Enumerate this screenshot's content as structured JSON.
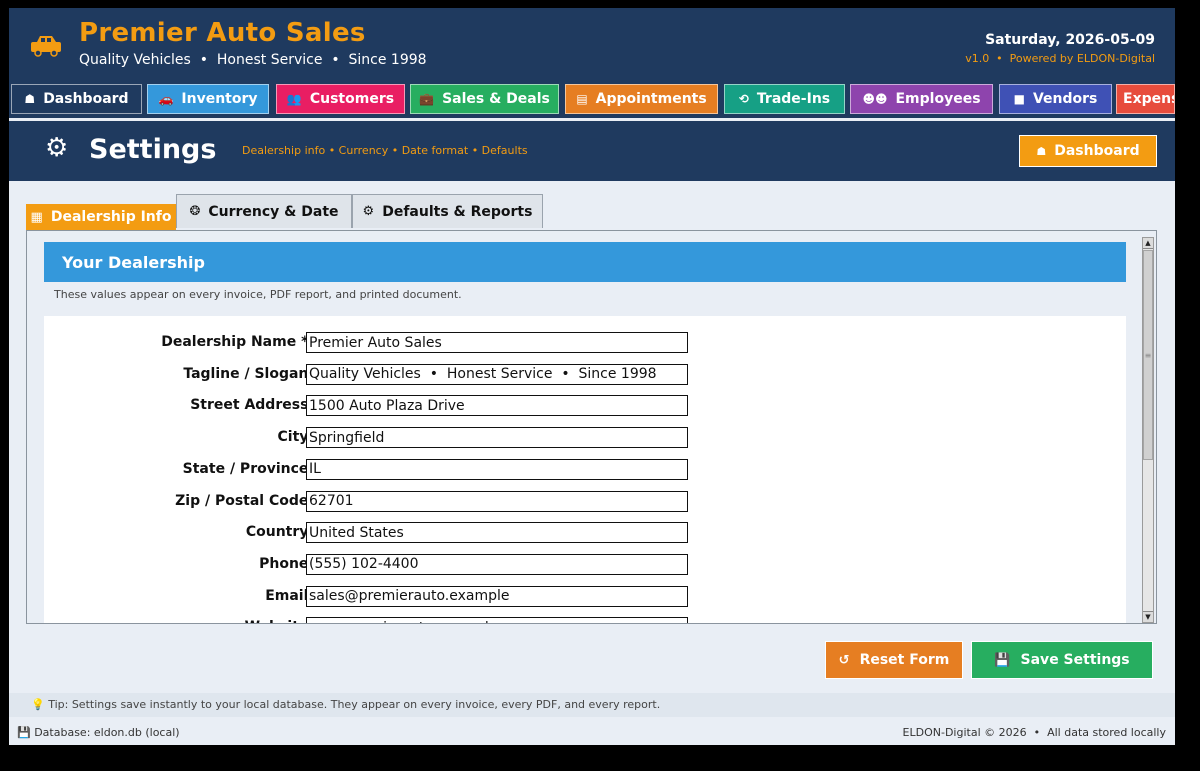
{
  "app": {
    "title": "Premier Auto Sales",
    "tagline": "Quality Vehicles  •  Honest Service  •  Since 1998",
    "date": "Saturday, 2026-05-09",
    "version": "v1.0  •  Powered by ELDON-Digital",
    "logo_icon": "car-icon"
  },
  "nav": [
    {
      "label": "Dashboard",
      "icon": "home-icon",
      "glyph": "☗",
      "color": "#1f3a5f"
    },
    {
      "label": "Inventory",
      "icon": "car-icon",
      "glyph": "🚗",
      "color": "#3498db"
    },
    {
      "label": "Customers",
      "icon": "people-icon",
      "glyph": "👥",
      "color": "#e91e63"
    },
    {
      "label": "Sales & Deals",
      "icon": "briefcase-icon",
      "glyph": "💼",
      "color": "#27ae60"
    },
    {
      "label": "Appointments",
      "icon": "calendar-icon",
      "glyph": "▤",
      "color": "#e67e22"
    },
    {
      "label": "Trade-Ins",
      "icon": "cycle-icon",
      "glyph": "⟲",
      "color": "#16a085"
    },
    {
      "label": "Employees",
      "icon": "staff-icon",
      "glyph": "☻☻",
      "color": "#8e44ad"
    },
    {
      "label": "Vendors",
      "icon": "box-icon",
      "glyph": "■",
      "color": "#3f51b5"
    },
    {
      "label": "Expens",
      "icon": "money-icon",
      "glyph": "",
      "color": "#e74c3c"
    }
  ],
  "page": {
    "title": "Settings",
    "subtitle": "Dealership info • Currency • Date format • Defaults",
    "dashboard_button": "Dashboard"
  },
  "tabs": [
    {
      "label": "Dealership Info",
      "icon": "building-icon",
      "glyph": "▦",
      "active": true
    },
    {
      "label": "Currency & Date",
      "icon": "globe-icon",
      "glyph": "❂",
      "active": false
    },
    {
      "label": "Defaults & Reports",
      "icon": "gear-icon",
      "glyph": "⚙",
      "active": false
    }
  ],
  "section": {
    "title": "Your Dealership",
    "note": "These values appear on every invoice, PDF report, and printed document."
  },
  "fields": [
    {
      "label": "Dealership Name *:",
      "value": "Premier Auto Sales"
    },
    {
      "label": "Tagline / Slogan:",
      "value": "Quality Vehicles  •  Honest Service  •  Since 1998"
    },
    {
      "label": "Street Address:",
      "value": "1500 Auto Plaza Drive"
    },
    {
      "label": "City:",
      "value": "Springfield"
    },
    {
      "label": "State / Province:",
      "value": "IL"
    },
    {
      "label": "Zip / Postal Code:",
      "value": "62701"
    },
    {
      "label": "Country:",
      "value": "United States"
    },
    {
      "label": "Phone:",
      "value": "(555) 102-4400"
    },
    {
      "label": "Email:",
      "value": "sales@premierauto.example"
    },
    {
      "label": "Website:",
      "value": "www.premierauto.example"
    }
  ],
  "actions": {
    "reset": "Reset Form",
    "save": "Save Settings"
  },
  "footer": {
    "tip": "Tip: Settings save instantly to your local database. They appear on every invoice, every PDF, and every report.",
    "database": "Database: eldon.db (local)",
    "copyright": "ELDON-Digital © 2026  •  All data stored locally"
  },
  "colors": {
    "header_bg": "#1f3a5f",
    "accent_orange": "#f39c12",
    "section_blue": "#3498db",
    "reset_orange": "#e67e22",
    "save_green": "#27ae60"
  }
}
